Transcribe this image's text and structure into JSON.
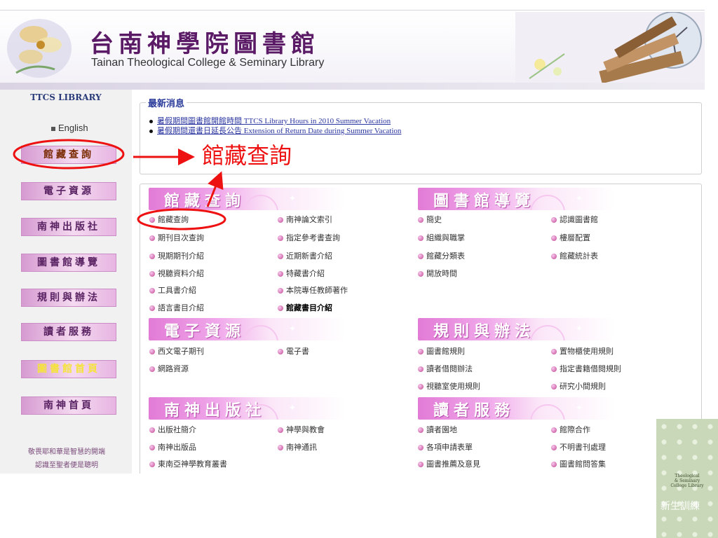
{
  "header": {
    "title_cn": "台南神學院圖書館",
    "title_en": "Tainan Theological College & Seminary Library"
  },
  "sidebar": {
    "title": "TTCS LIBRARY",
    "english_link": "English",
    "items": [
      {
        "label": "館藏查詢"
      },
      {
        "label": "電子資源"
      },
      {
        "label": "南神出版社"
      },
      {
        "label": "圖書館導覽"
      },
      {
        "label": "規則與辦法"
      },
      {
        "label": "讀者服務"
      },
      {
        "label": "圖書館首頁"
      },
      {
        "label": "南神首頁"
      }
    ],
    "footer_lines": [
      "敬畏耶和華是智慧的開端",
      "認識至聖者便是聰明"
    ]
  },
  "news": {
    "heading": "最新消息",
    "items": [
      "暑假期間圖書館開館時間 TTCS Library Hours in 2010 Summer Vacation",
      "暑假期間還書日延長公告 Extension of Return Date during Summer Vacation"
    ]
  },
  "annotation": {
    "label": "館藏查詢"
  },
  "sections": {
    "collection": {
      "title": "館藏查詢",
      "col1": [
        "館藏查詢",
        "期刊目次查詢",
        "現期期刊介紹",
        "視聽資料介紹",
        "工具書介紹",
        "語言書目介紹"
      ],
      "col2": [
        "南神論文索引",
        "指定參考書查詢",
        "近期新書介紹",
        "特藏書介紹",
        "本院專任教師著作",
        "館藏書目介紹"
      ]
    },
    "guide": {
      "title": "圖書館導覽",
      "col1": [
        "簡史",
        "組織與職掌",
        "館藏分類表",
        "開放時間"
      ],
      "col2": [
        "認識圖書館",
        "樓層配置",
        "館藏統計表"
      ]
    },
    "eresources": {
      "title": "電子資源",
      "col1": [
        "西文電子期刊",
        "網路資源"
      ],
      "col2": [
        "電子書"
      ]
    },
    "rules": {
      "title": "規則與辦法",
      "col1": [
        "圖書館規則",
        "讀者借閱辦法",
        "視聽室使用規則"
      ],
      "col2": [
        "置物櫃使用規則",
        "指定書籍借閱規則",
        "研究小間規則"
      ]
    },
    "press": {
      "title": "南神出版社",
      "col1": [
        "出版社簡介",
        "南神出版品",
        "東南亞神學教育叢書"
      ],
      "col2": [
        "神學與教會",
        "南神通訊"
      ]
    },
    "service": {
      "title": "讀者服務",
      "col1": [
        "讀者園地",
        "各項申請表單",
        "圖書推薦及意見"
      ],
      "col2": [
        "館際合作",
        "不明書刊處理",
        "圖書館問答集"
      ]
    }
  },
  "corner": {
    "small_text": [
      "Theological",
      "& Seminary",
      "College Library"
    ],
    "label": "新生訓練"
  },
  "colors": {
    "brand_purple": "#5a1a66",
    "link_blue": "#2a35a0",
    "annotation_red": "#ee1111",
    "banner_pink": "#e27bd6"
  }
}
